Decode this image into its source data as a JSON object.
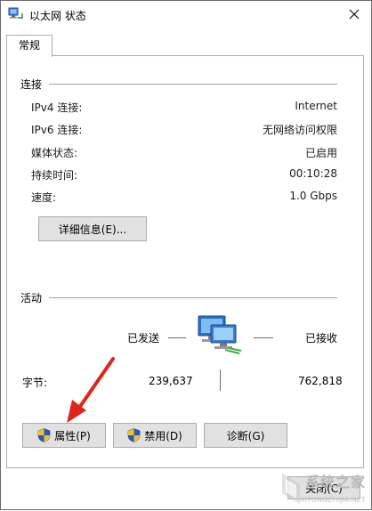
{
  "window": {
    "title": "以太网 状态"
  },
  "tabs": [
    {
      "label": "常规"
    }
  ],
  "connection": {
    "group_label": "连接",
    "rows": [
      {
        "label": "IPv4 连接:",
        "value": "Internet"
      },
      {
        "label": "IPv6 连接:",
        "value": "无网络访问权限"
      },
      {
        "label": "媒体状态:",
        "value": "已启用"
      },
      {
        "label": "持续时间:",
        "value": "00:10:28"
      },
      {
        "label": "速度:",
        "value": "1.0 Gbps"
      }
    ],
    "details_button": "详细信息(E)..."
  },
  "activity": {
    "group_label": "活动",
    "sent_label": "已发送",
    "received_label": "已接收",
    "bytes_label": "字节:",
    "bytes_sent": "239,637",
    "bytes_received": "762,818"
  },
  "buttons": {
    "properties": "属性(P)",
    "disable": "禁用(D)",
    "diagnose": "诊断(G)",
    "close": "关闭(C)"
  },
  "watermark": {
    "text": "系统之家",
    "sub": "XITONGZHIJIA.NET"
  },
  "colors": {
    "annotation_arrow": "#e0241b",
    "shield_blue": "#2a5ab8",
    "shield_yellow": "#f2c12e"
  }
}
